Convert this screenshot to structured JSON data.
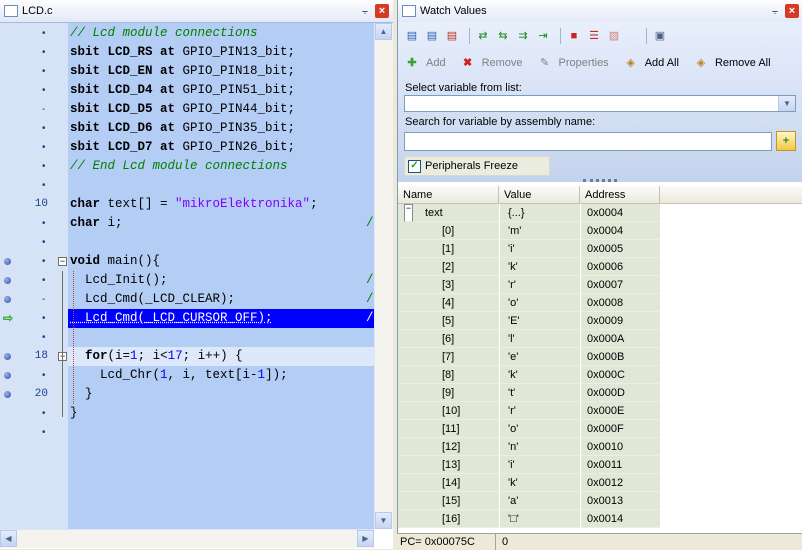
{
  "editor": {
    "title": "LCD.c",
    "lines": [
      {
        "parts": [
          {
            "t": "// Lcd module connections",
            "c": "cmt"
          }
        ]
      },
      {
        "parts": [
          {
            "t": "sbit LCD_RS ",
            "c": "b"
          },
          {
            "t": "at",
            "c": "b"
          },
          {
            "t": " GPIO_PIN13_bit;",
            "c": ""
          }
        ]
      },
      {
        "parts": [
          {
            "t": "sbit LCD_EN ",
            "c": "b"
          },
          {
            "t": "at",
            "c": "b"
          },
          {
            "t": " GPIO_PIN18_bit;",
            "c": ""
          }
        ]
      },
      {
        "parts": [
          {
            "t": "sbit LCD_D4 ",
            "c": "b"
          },
          {
            "t": "at",
            "c": "b"
          },
          {
            "t": " GPIO_PIN51_bit;",
            "c": ""
          }
        ]
      },
      {
        "parts": [
          {
            "t": "sbit LCD_D5 ",
            "c": "b"
          },
          {
            "t": "at",
            "c": "b"
          },
          {
            "t": " GPIO_PIN44_bit;",
            "c": ""
          }
        ]
      },
      {
        "parts": [
          {
            "t": "sbit LCD_D6 ",
            "c": "b"
          },
          {
            "t": "at",
            "c": "b"
          },
          {
            "t": " GPIO_PIN35_bit;",
            "c": ""
          }
        ]
      },
      {
        "parts": [
          {
            "t": "sbit LCD_D7 ",
            "c": "b"
          },
          {
            "t": "at",
            "c": "b"
          },
          {
            "t": " GPIO_PIN26_bit;",
            "c": ""
          }
        ]
      },
      {
        "parts": [
          {
            "t": "// End Lcd module connections",
            "c": "cmt"
          }
        ]
      },
      {
        "parts": []
      },
      {
        "parts": [
          {
            "t": "char",
            "c": "b"
          },
          {
            "t": " text[] = ",
            "c": ""
          },
          {
            "t": "\"mikroElektronika\"",
            "c": "str"
          },
          {
            "t": ";",
            "c": ""
          }
        ]
      },
      {
        "parts": [
          {
            "t": "char",
            "c": "b"
          },
          {
            "t": " i;",
            "c": ""
          }
        ]
      },
      {
        "parts": []
      },
      {
        "parts": [
          {
            "t": "void",
            "c": "b"
          },
          {
            "t": " main(){",
            "c": ""
          }
        ]
      },
      {
        "parts": [
          {
            "t": "  Lcd_Init();",
            "c": ""
          }
        ]
      },
      {
        "parts": [
          {
            "t": "  Lcd_Cmd(_LCD_CLEAR);",
            "c": ""
          }
        ]
      },
      {
        "parts": [
          {
            "t": "  Lcd_Cmd(_LCD_CURSOR_OFF);",
            "c": "cur"
          }
        ]
      },
      {
        "parts": []
      },
      {
        "parts": [
          {
            "t": "  ",
            "c": ""
          },
          {
            "t": "for",
            "c": "b"
          },
          {
            "t": "(i=",
            "c": ""
          },
          {
            "t": "1",
            "c": "num"
          },
          {
            "t": "; i<",
            "c": ""
          },
          {
            "t": "17",
            "c": "num"
          },
          {
            "t": "; i++) {",
            "c": ""
          }
        ]
      },
      {
        "parts": [
          {
            "t": "    Lcd_Chr(",
            "c": ""
          },
          {
            "t": "1",
            "c": "num"
          },
          {
            "t": ", i, text[i-",
            "c": ""
          },
          {
            "t": "1",
            "c": "num"
          },
          {
            "t": "]);",
            "c": ""
          }
        ]
      },
      {
        "parts": [
          {
            "t": "  }",
            "c": ""
          }
        ]
      },
      {
        "parts": [
          {
            "t": "}",
            "c": ""
          }
        ]
      },
      {
        "parts": []
      }
    ],
    "line_numbers": [
      "10",
      "18",
      "20"
    ]
  },
  "watch": {
    "title": "Watch Values",
    "add_label": "Add",
    "remove_label": "Remove",
    "properties_label": "Properties",
    "add_all_label": "Add All",
    "remove_all_label": "Remove All",
    "select_label": "Select variable from list:",
    "search_label": "Search for variable by assembly name:",
    "freeze_label": "Peripherals Freeze",
    "columns": {
      "name": "Name",
      "value": "Value",
      "address": "Address"
    },
    "root": {
      "name": "text",
      "value": "{...}",
      "address": "0x0004"
    },
    "rows": [
      {
        "name": "[0]",
        "value": "'m'",
        "address": "0x0004"
      },
      {
        "name": "[1]",
        "value": "'i'",
        "address": "0x0005"
      },
      {
        "name": "[2]",
        "value": "'k'",
        "address": "0x0006"
      },
      {
        "name": "[3]",
        "value": "'r'",
        "address": "0x0007"
      },
      {
        "name": "[4]",
        "value": "'o'",
        "address": "0x0008"
      },
      {
        "name": "[5]",
        "value": "'E'",
        "address": "0x0009"
      },
      {
        "name": "[6]",
        "value": "'l'",
        "address": "0x000A"
      },
      {
        "name": "[7]",
        "value": "'e'",
        "address": "0x000B"
      },
      {
        "name": "[8]",
        "value": "'k'",
        "address": "0x000C"
      },
      {
        "name": "[9]",
        "value": "'t'",
        "address": "0x000D"
      },
      {
        "name": "[10]",
        "value": "'r'",
        "address": "0x000E"
      },
      {
        "name": "[11]",
        "value": "'o'",
        "address": "0x000F"
      },
      {
        "name": "[12]",
        "value": "'n'",
        "address": "0x0010"
      },
      {
        "name": "[13]",
        "value": "'i'",
        "address": "0x0011"
      },
      {
        "name": "[14]",
        "value": "'k'",
        "address": "0x0012"
      },
      {
        "name": "[15]",
        "value": "'a'",
        "address": "0x0013"
      },
      {
        "name": "[16]",
        "value": "'□'",
        "address": "0x0014"
      }
    ],
    "status_pc": "PC= 0x00075C",
    "status_val": "0"
  },
  "colors": {
    "accent": "#3a6ea5",
    "current_line": "#0000ff",
    "code_bg": "#b4cdf4"
  }
}
